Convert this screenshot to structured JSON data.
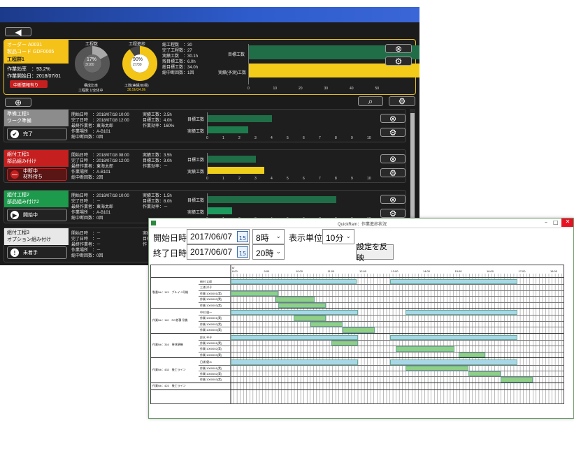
{
  "monitor": {
    "order": {
      "order_no": "オーダー A0031",
      "product_code": "製品コード GDF0005",
      "process_group": "工程群1",
      "efficiency": "作業効率　：93.2%",
      "start_date": "作業開始日：2018/07/01",
      "interrupt_badge": "中断情報有り",
      "process_count_label": "工程数",
      "process_progress_label": "工程進捗",
      "donut1_pct": "17%",
      "donut1_ratio": "3/180",
      "donut1_sub1": "構成比率",
      "donut1_sub2": "工程数 1/全体中",
      "donut2_pct": "90%",
      "donut2_ratio": "27/30",
      "donut2_sub1": "工数(実績/目標)",
      "donut2_sub2": "36.5h/34.0h",
      "stats": [
        "総工程数　：30",
        "完了工程数：27",
        "実績工数　：30.1h",
        "残目標工数：6.0h",
        "総目標工数：34.0h",
        "総中断回数：1回"
      ],
      "chart_label_target": "目標工数",
      "chart_label_actual": "実績(予測)工数",
      "axis_ticks": [
        "0",
        "10",
        "20",
        "30",
        "40",
        "50"
      ],
      "target_value": 36,
      "actual_value": 36.5,
      "actual_overrun_value": 2.5
    },
    "processes": [
      {
        "name": "準備工程1",
        "sub": "ワーク準備",
        "status": "完了",
        "color": "#8c8c8c",
        "lines": [
          "開始日時　：2018/07/18 10:00",
          "完了日時　：2018/07/18 12:00",
          "最終作業者：東海太郎",
          "作業場所　：A-B101",
          "総中断回数：0回"
        ],
        "lines2": [
          "実績工数：2.5h",
          "目標工数：4.0h",
          "作業効率：160%"
        ],
        "target": 4.0,
        "actual": 2.5,
        "actual_color": "#1e7c4c"
      },
      {
        "name": "組付工程1",
        "sub": "部品組み付け",
        "status": "中断中",
        "status2": "材料待ち",
        "color": "#c61f1f",
        "lines": [
          "開始日時　：2018/07/18 08:00",
          "完了日時　：2018/07/18 12:00",
          "最終作業者：東海太郎",
          "作業場所　：A-B101",
          "総中断回数：2回"
        ],
        "lines2": [
          "実績工数：3.5h",
          "目標工数：3.0h",
          "作業効率：－"
        ],
        "target": 3.0,
        "actual": 3.5,
        "actual_color": "#f0cf1a"
      },
      {
        "name": "組付工程2",
        "sub": "部品組み付け2",
        "status": "開始中",
        "color": "#1d9a4c",
        "lines": [
          "開始日時　：2018/07/18 10:00",
          "完了日時　：－",
          "最終作業者：東海太郎",
          "作業場所　：A-B101",
          "総中断回数：0回"
        ],
        "lines2": [
          "実績工数：1.5h",
          "目標工数：8.0h",
          "作業効率：－"
        ],
        "target": 8.0,
        "actual": 1.5,
        "actual_color": "#1d9a5e"
      },
      {
        "name": "組付工程3",
        "sub": "オプション組み付け",
        "status": "未着手",
        "color": "#e8e8e8",
        "lines": [
          "開始日時　：－",
          "完了日時　：－",
          "最終作業者：－",
          "作業場所　：－",
          "総中断回数：0回"
        ],
        "lines2": [
          "実績工数：－",
          "目標工数：",
          "作"
        ],
        "target": 0,
        "actual": 0,
        "actual_color": "#1d9a5e"
      }
    ],
    "card_chart_labels": {
      "target": "目標工数",
      "actual": "実績工数"
    },
    "card_axis_ticks": [
      "0",
      "1",
      "2",
      "3",
      "4",
      "5",
      "6",
      "7",
      "8",
      "9",
      "10"
    ]
  },
  "gantt_window": {
    "title": "QuickRam：作業進捗状況",
    "start_label": "開始日時",
    "end_label": "終了日時",
    "start_date": "2017/06/07",
    "end_date": "2017/06/07",
    "start_hour": "8時",
    "end_hour": "20時",
    "unit_label": "表示単位",
    "unit_value": "10分",
    "apply_button": "設定を反映",
    "calendar_day": "15",
    "date_header": "6/",
    "hours": [
      "8:00",
      "9:00",
      "10:00",
      "11:00",
      "12:00",
      "13:00",
      "14:00",
      "15:00",
      "16:00",
      "17:00",
      "18:00"
    ],
    "groups": [
      {
        "label": "製番Nb：113　ブルイ-1号機",
        "rows": [
          "新村 太郎",
          "三浦 洋子",
          "作業:1000001(実)",
          "作業:1000002(実)",
          "作業:1000003(実)"
        ]
      },
      {
        "label": "作業Nb：110　RC差積 吊機",
        "rows": [
          "中村 雄一",
          "作業:1000001(実)",
          "作業:1000002(実)",
          "作業:1000003(実)"
        ]
      },
      {
        "label": "作業Nb：316　昼休憩機",
        "rows": [
          "鈴木 平子",
          "作業:1000001(実)",
          "作業:1000002(実)",
          "作業:1000003(実)"
        ]
      },
      {
        "label": "作業Nb：433　後工ライン",
        "rows": [
          "日浦 健二",
          "作業:1000001(実)",
          "作業:1000002(実)",
          "作業:1000003(実)"
        ]
      },
      {
        "label": "作業Nb：423　後工ライン",
        "rows": []
      }
    ]
  }
}
